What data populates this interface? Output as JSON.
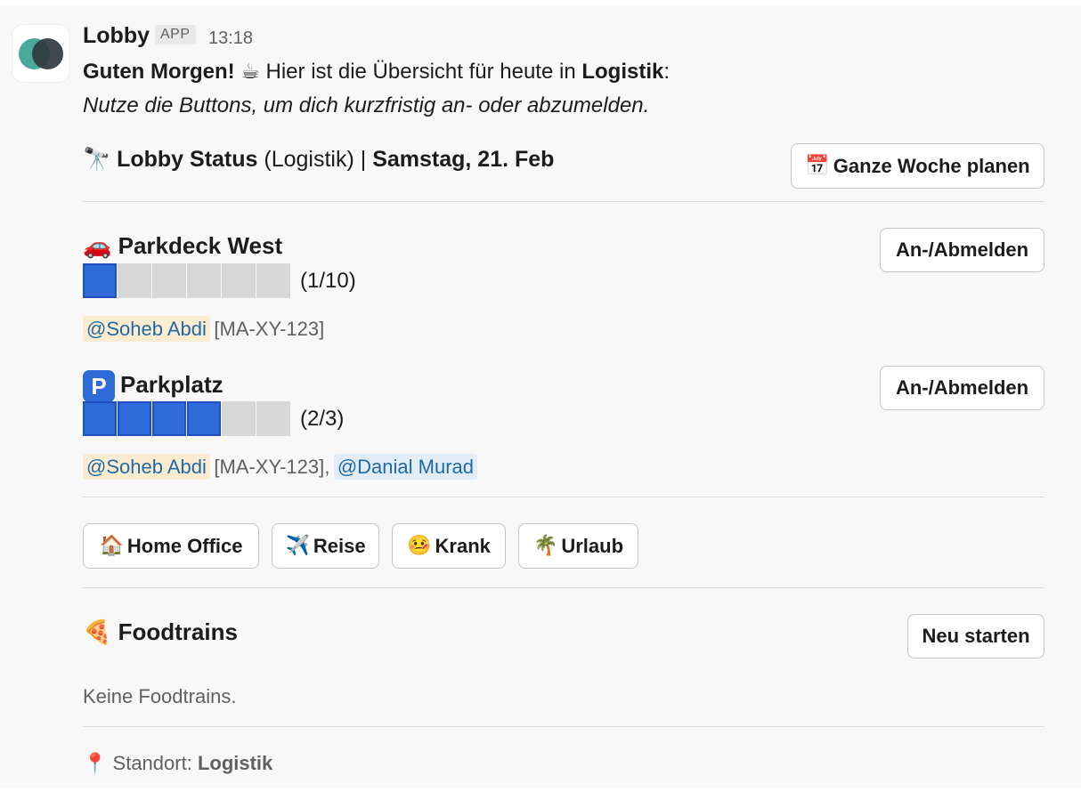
{
  "message": {
    "sender": "Lobby",
    "badge": "APP",
    "time": "13:18",
    "greeting_bold": "Guten Morgen!",
    "greeting_emoji": "☕",
    "greeting_rest": "Hier ist die Übersicht für heute in",
    "greeting_location": "Logistik",
    "greeting_colon": ":",
    "italic_note": "Nutze die Buttons, um dich kurzfristig an- oder abzumelden."
  },
  "status": {
    "emoji": "🔭",
    "label": "Lobby Status",
    "scope": "(Logistik) |",
    "date": "Samstag, 21. Feb",
    "plan_button_emoji": "📅",
    "plan_button": "Ganze Woche planen"
  },
  "parking": [
    {
      "emoji": "🚗",
      "name": "Parkdeck West",
      "count": "(1/10)",
      "fill_fraction": 0.1,
      "button": "An-/Abmelden",
      "people": [
        {
          "mention": "@Soheb Abdi",
          "plate": "[MA-XY-123]"
        }
      ]
    },
    {
      "emoji": "P",
      "name": "Parkplatz",
      "count": "(2/3)",
      "fill_fraction": 0.667,
      "button": "An-/Abmelden",
      "people": [
        {
          "mention": "@Soheb Abdi",
          "plate": "[MA-XY-123],"
        },
        {
          "mention": "@Danial Murad",
          "plate": ""
        }
      ]
    }
  ],
  "quick_buttons": [
    {
      "emoji": "🏠",
      "label": "Home Office"
    },
    {
      "emoji": "✈️",
      "label": "Reise"
    },
    {
      "emoji": "🤒",
      "label": "Krank"
    },
    {
      "emoji": "🌴",
      "label": "Urlaub"
    }
  ],
  "foodtrains": {
    "emoji": "🍕",
    "title": "Foodtrains",
    "button": "Neu starten",
    "empty": "Keine Foodtrains."
  },
  "footer": {
    "pin_emoji": "📍",
    "label": "Standort:",
    "location": "Logistik"
  },
  "colors": {
    "bar_filled": "#2f6bd8",
    "bar_empty": "#d7d7d7",
    "mention_bg_self": "#fbecd1",
    "mention_bg_other": "#e1ecf7"
  }
}
